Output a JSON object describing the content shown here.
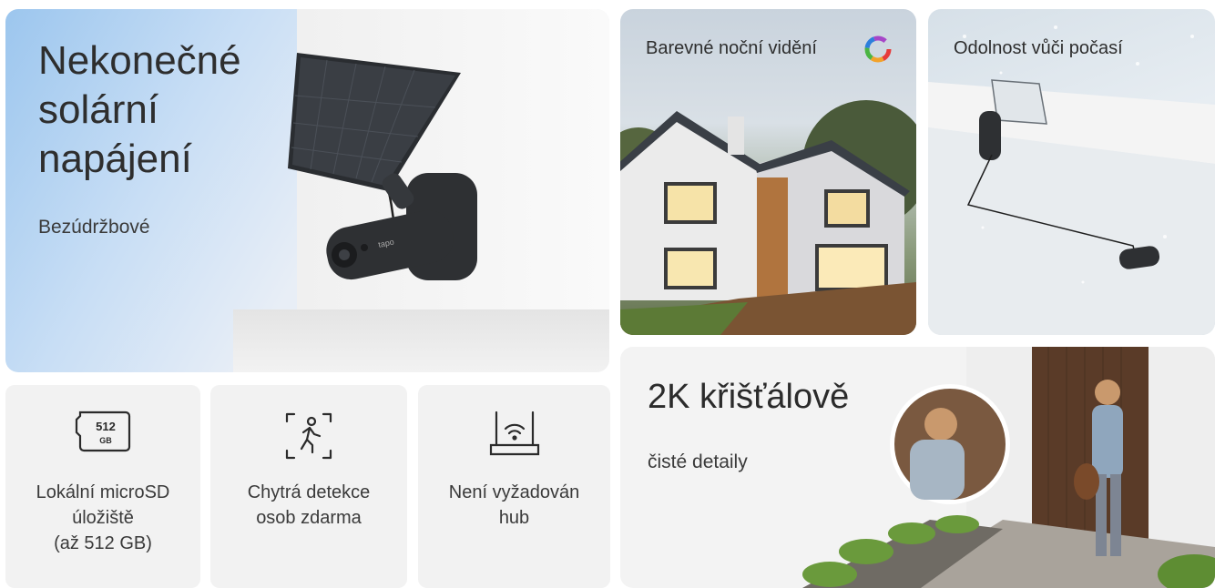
{
  "solar": {
    "title": "Nekonečné\nsolární\nnapájení",
    "subtitle": "Bezúdržbové",
    "camera_brand": "tapo"
  },
  "features": [
    {
      "label": "Lokální microSD\núložiště\n(až 512 GB)",
      "icon": "microsd-card-icon",
      "icon_text": "512",
      "icon_subtext": "GB"
    },
    {
      "label": "Chytrá detekce\nosob zdarma",
      "icon": "person-detection-icon"
    },
    {
      "label": "Není vyžadován\nhub",
      "icon": "router-icon"
    }
  ],
  "night": {
    "title": "Barevné noční vidění"
  },
  "weather": {
    "title": "Odolnost vůči počasí"
  },
  "clarity": {
    "title": "2K křišťálově",
    "subtitle": "čisté detaily"
  },
  "colors": {
    "text": "#2b2b2b",
    "tile_bg": "#f2f2f2",
    "sky_blue": "#9cc6ee",
    "camera": "#2e3033"
  }
}
